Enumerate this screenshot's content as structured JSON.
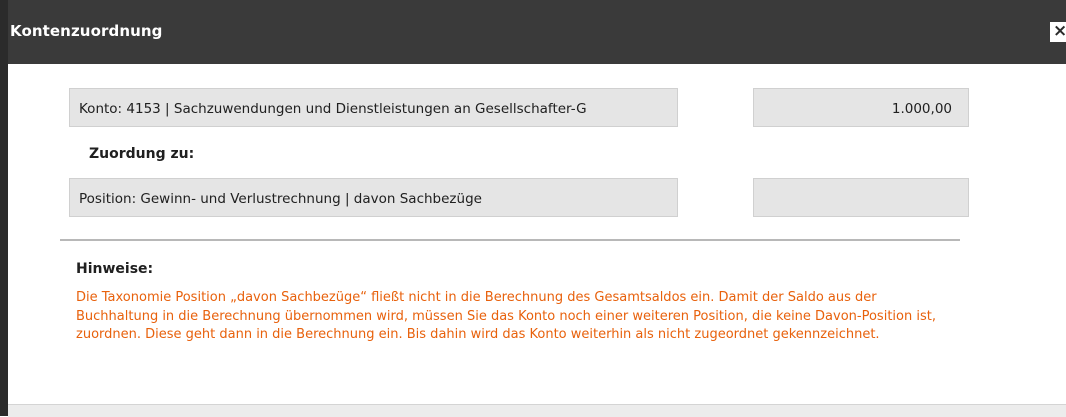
{
  "dialog": {
    "title": "Kontenzuordnung",
    "close_glyph": "×",
    "close_icon": "close-icon"
  },
  "konto": {
    "label": "Konto: 4153 | Sachzuwendungen und Dienstleistungen an Gesellschafter-G",
    "amount": "1.000,00"
  },
  "zuordnung": {
    "label": "Zuordung zu:",
    "position": "Position: Gewinn- und Verlustrechnung | davon Sachbezüge",
    "amount": ""
  },
  "hinweise": {
    "label": "Hinweise:",
    "text": "Die Taxonomie Position „davon Sachbezüge“ fließt nicht in die Berechnung des Gesamtsaldos ein. Damit der Saldo aus der Buchhaltung in die Berechnung übernommen wird, müssen Sie das Konto noch einer weiteren Position, die keine Davon-Position ist, zuordnen. Diese geht dann in die Berechnung ein. Bis dahin wird das Konto weiterhin als nicht zugeordnet gekennzeichnet."
  },
  "colors": {
    "title_bar": "#3a3a3a",
    "field_bg": "#e5e5e5",
    "hint_text": "#e8610c"
  }
}
